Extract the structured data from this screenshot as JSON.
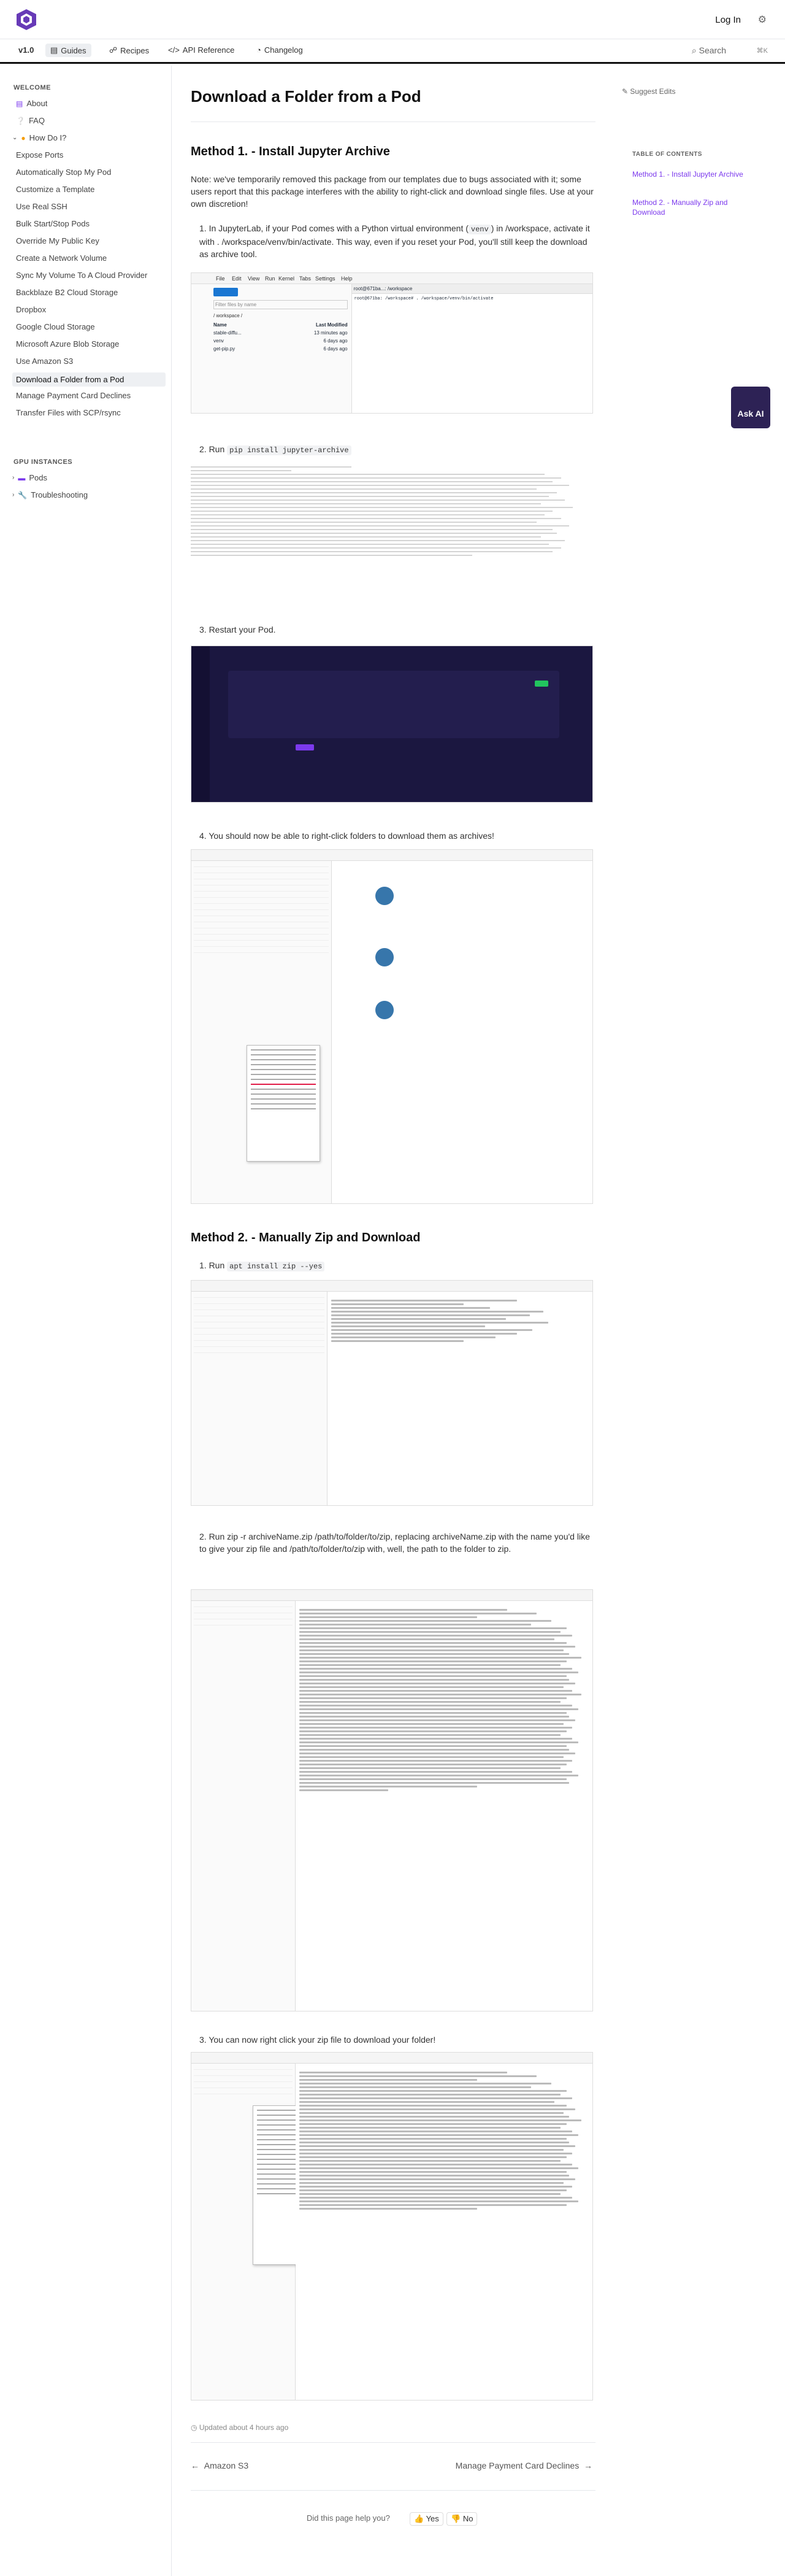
{
  "header": {
    "login": "Log In"
  },
  "nav": {
    "version": "v1.0",
    "guides": "Guides",
    "recipes": "Recipes",
    "api": "API Reference",
    "changelog": "Changelog",
    "search": "Search",
    "kbd": "⌘K"
  },
  "sidebar": {
    "welcome": "WELCOME",
    "gpu": "GPU INSTANCES",
    "items": [
      "About",
      "FAQ",
      "How Do I?",
      "Expose Ports",
      "Automatically Stop My Pod",
      "Customize a Template",
      "Use Real SSH",
      "Bulk Start/Stop Pods",
      "Override My Public Key",
      "Create a Network Volume",
      "Sync My Volume To A Cloud Provider",
      "Backblaze B2 Cloud Storage",
      "Dropbox",
      "Google Cloud Storage",
      "Microsoft Azure Blob Storage",
      "Use Amazon S3",
      "Download a Folder from a Pod",
      "Manage Payment Card Declines",
      "Transfer Files with SCP/rsync"
    ],
    "gpu_items": [
      "Pods",
      "Troubleshooting"
    ]
  },
  "page": {
    "title": "Download a Folder from a Pod",
    "suggest": "Suggest Edits",
    "m1": "Method 1. - Install Jupyter Archive",
    "note": "Note: we've temporarily removed this package from our templates due to bugs associated with it; some users report that this package interferes with the ability to right-click and download single files. Use at your own discretion!",
    "s1a": "1. In JupyterLab, if your Pod comes with a Python virtual environment (",
    "s1code": "venv",
    "s1b": ") in /workspace, activate it with . /workspace/venv/bin/activate. This way, even if you reset your Pod, you'll still keep the download as archive tool.",
    "s2a": "2. Run ",
    "s2code": "pip install jupyter-archive",
    "s3": "3. Restart your Pod.",
    "s4": "4. You should now be able to right-click folders to download them as archives!",
    "m2": "Method 2. - Manually Zip and Download",
    "m2s1a": "1. Run ",
    "m2s1code": "apt install zip --yes",
    "m2s2": "2. Run zip -r archiveName.zip /path/to/folder/to/zip, replacing archiveName.zip with the name you'd like to give your zip file and /path/to/folder/to/zip with, well, the path to the folder to zip.",
    "m2s3": "3. You can now right click your zip file to download your folder!",
    "updated": "Updated about 4 hours ago",
    "prev": "Amazon S3",
    "next": "Manage Payment Card Declines",
    "helpful": "Did this page help you?",
    "yes": "Yes",
    "no": "No"
  },
  "toc": {
    "title": "TABLE OF CONTENTS",
    "i1": "Method 1. - Install Jupyter Archive",
    "i2": "Method 2. - Manually Zip and Download"
  },
  "askai": "Ask AI",
  "jupyter": {
    "menu": [
      "File",
      "Edit",
      "View",
      "Run",
      "Kernel",
      "Tabs",
      "Settings",
      "Help"
    ],
    "filter": "Filter files by name",
    "path": "/ workspace /",
    "col_name": "Name",
    "col_mod": "Last Modified",
    "files": [
      "stable-diffu...",
      "venv",
      "get-pip.py"
    ],
    "mods": [
      "13 minutes ago",
      "6 days ago",
      "6 days ago"
    ],
    "term_tab": "root@671ba...: /workspace",
    "cmd": "root@671ba: /workspace# . /workspace/venv/bin/activate"
  },
  "colors": {
    "accent": "#7c3aed",
    "nav_active": "#eceef1"
  }
}
